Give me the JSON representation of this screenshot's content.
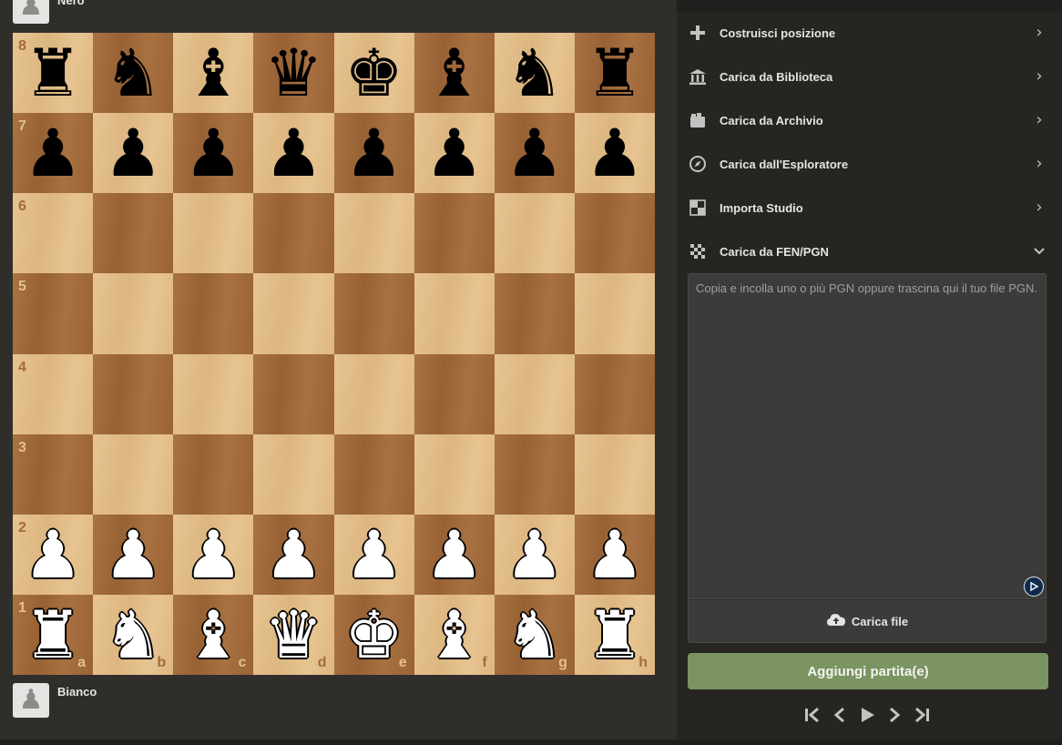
{
  "players": {
    "top": {
      "name": "Nero"
    },
    "bottom": {
      "name": "Bianco"
    }
  },
  "board": {
    "ranks": [
      "8",
      "7",
      "6",
      "5",
      "4",
      "3",
      "2",
      "1"
    ],
    "files": [
      "a",
      "b",
      "c",
      "d",
      "e",
      "f",
      "g",
      "h"
    ],
    "position": [
      [
        "r",
        "n",
        "b",
        "q",
        "k",
        "b",
        "n",
        "r"
      ],
      [
        "p",
        "p",
        "p",
        "p",
        "p",
        "p",
        "p",
        "p"
      ],
      [
        "",
        "",
        "",
        "",
        "",
        "",
        "",
        ""
      ],
      [
        "",
        "",
        "",
        "",
        "",
        "",
        "",
        ""
      ],
      [
        "",
        "",
        "",
        "",
        "",
        "",
        "",
        ""
      ],
      [
        "",
        "",
        "",
        "",
        "",
        "",
        "",
        ""
      ],
      [
        "P",
        "P",
        "P",
        "P",
        "P",
        "P",
        "P",
        "P"
      ],
      [
        "R",
        "N",
        "B",
        "Q",
        "K",
        "B",
        "N",
        "R"
      ]
    ],
    "colors": {
      "light": "#e5c08a",
      "dark": "#a46b3a"
    }
  },
  "sidebar": {
    "menu": [
      {
        "label": "Costruisci posizione",
        "icon": "plus-icon",
        "chevron": "chevron-right-icon"
      },
      {
        "label": "Carica da Biblioteca",
        "icon": "library-icon",
        "chevron": "chevron-right-icon"
      },
      {
        "label": "Carica da Archivio",
        "icon": "archive-icon",
        "chevron": "chevron-right-icon"
      },
      {
        "label": "Carica dall'Esploratore",
        "icon": "compass-icon",
        "chevron": "chevron-right-icon"
      },
      {
        "label": "Importa Studio",
        "icon": "study-icon",
        "chevron": "chevron-right-icon"
      },
      {
        "label": "Carica da FEN/PGN",
        "icon": "checkerboard-icon",
        "chevron": "chevron-down-icon"
      }
    ],
    "pgn_input": {
      "value": "",
      "placeholder": "Copia e incolla uno o più PGN oppure trascina qui il tuo file PGN."
    },
    "upload_label": "Carica file",
    "add_label": "Aggiungi partita(e)",
    "accent": "#7b9462",
    "nav_controls": [
      "first-move-icon",
      "previous-move-icon",
      "play-icon",
      "next-move-icon",
      "last-move-icon"
    ]
  }
}
